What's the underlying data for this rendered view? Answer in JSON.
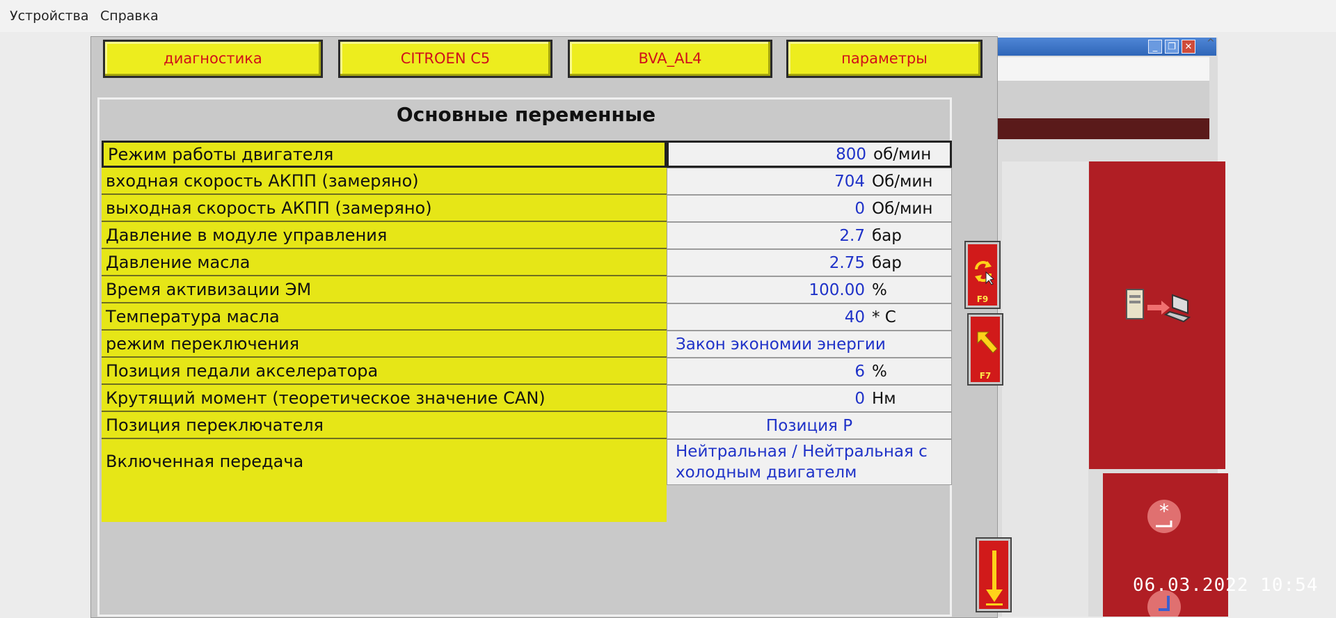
{
  "menubar": {
    "items": [
      "Устройства",
      "Справка"
    ]
  },
  "nav": {
    "buttons": [
      "диагностика",
      "CITROEN C5",
      "BVA_AL4",
      "параметры"
    ]
  },
  "panel": {
    "title": "Основные переменные"
  },
  "parameters": [
    {
      "label": "Режим работы двигателя",
      "value": "800",
      "unit": "об/мин"
    },
    {
      "label": "входная скорость АКПП (замеряно)",
      "value": "704",
      "unit": "Об/мин"
    },
    {
      "label": "выходная скорость АКПП (замеряно)",
      "value": "0",
      "unit": "Об/мин"
    },
    {
      "label": "Давление в модуле управления",
      "value": "2.7",
      "unit": "бар"
    },
    {
      "label": "Давление масла",
      "value": "2.75",
      "unit": "бар"
    },
    {
      "label": "Время активизации ЭМ",
      "value": "100.00",
      "unit": "%"
    },
    {
      "label": "Температура масла",
      "value": "40",
      "unit": "* C"
    },
    {
      "label": "режим переключения",
      "text": "Закон экономии энергии"
    },
    {
      "label": "Позиция педали акселератора",
      "value": "6",
      "unit": "%"
    },
    {
      "label": "Крутящий момент (теоретическое значение CAN)",
      "value": "0",
      "unit": "Нм"
    },
    {
      "label": "Позиция переключателя",
      "text": "Позиция P"
    },
    {
      "label": "Включенная передача",
      "text": "Нейтральная / Нейтральная с холодным двигателм"
    }
  ],
  "fkeys": [
    "F9",
    "F7"
  ],
  "timestamp": "06.03.2022 10:54",
  "colors": {
    "nav_yellow": "#eded1e",
    "label_yellow": "#e6e617",
    "value_blue": "#1f32c8",
    "accent_red": "#d11a1a"
  },
  "icons": [
    "refresh-icon",
    "arrow-up-left-icon",
    "arrow-down-icon",
    "pc-to-laptop-icon",
    "star-return-icon",
    "return-icon"
  ]
}
